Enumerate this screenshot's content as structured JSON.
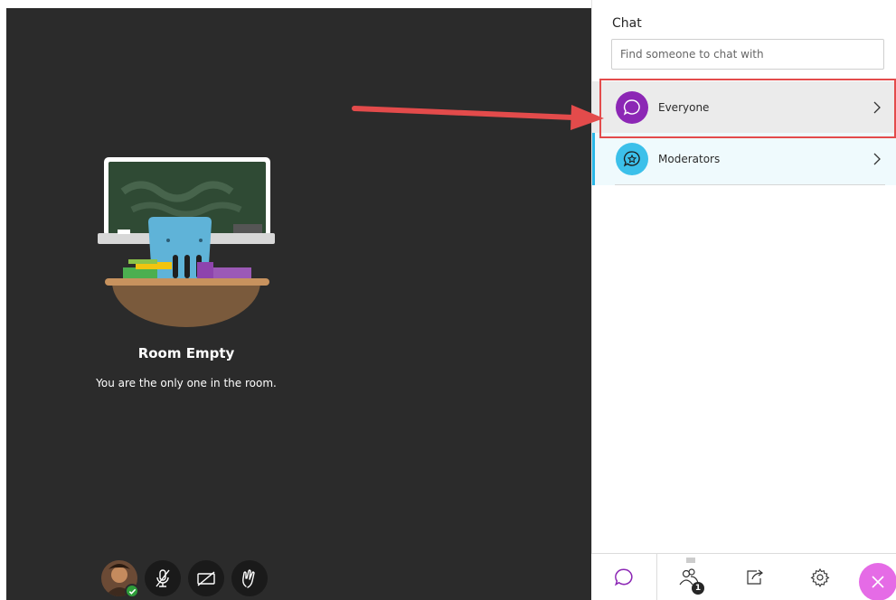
{
  "stage": {
    "room_title": "Room Empty",
    "room_subtitle": "You are the only one in the room.",
    "controls": [
      {
        "name": "avatar",
        "icon": "user-avatar-icon",
        "status": "online"
      },
      {
        "name": "microphone",
        "icon": "microphone-off-icon"
      },
      {
        "name": "camera",
        "icon": "camera-off-icon"
      },
      {
        "name": "raise-hand",
        "icon": "raise-hand-icon"
      }
    ]
  },
  "panel": {
    "title": "Chat",
    "search": {
      "placeholder": "Find someone to chat with",
      "value": ""
    },
    "channels": [
      {
        "label": "Everyone",
        "icon": "chat-bubble-icon",
        "icon_color": "#8c27b5",
        "selected": true
      },
      {
        "label": "Moderators",
        "icon": "moderator-chat-icon",
        "icon_color": "#3cc0ea",
        "selected": false
      }
    ]
  },
  "tabbar": {
    "tabs": [
      {
        "name": "chat",
        "icon": "chat-bubble-icon",
        "active": true
      },
      {
        "name": "attendees",
        "icon": "people-icon",
        "badge": "1"
      },
      {
        "name": "share-content",
        "icon": "share-icon"
      },
      {
        "name": "settings",
        "icon": "gear-icon"
      },
      {
        "name": "close-panel",
        "icon": "close-icon"
      }
    ]
  },
  "annotation": {
    "highlight_color": "#e34b4b",
    "arrow_color": "#e34b4b"
  }
}
